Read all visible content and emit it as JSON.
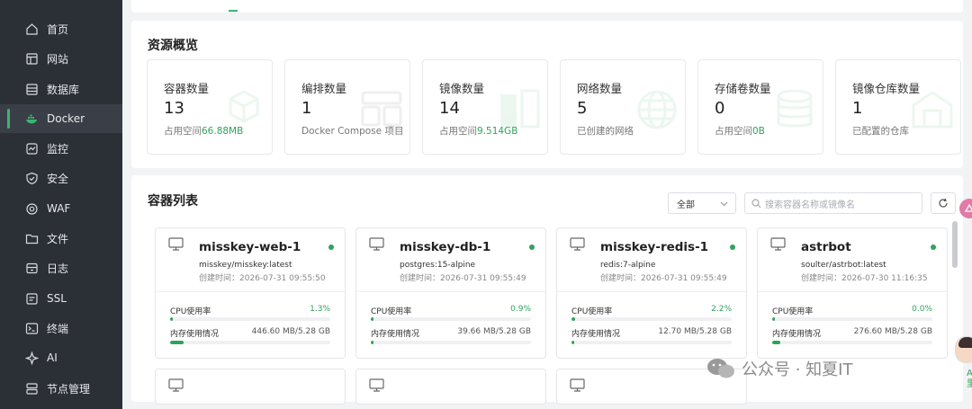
{
  "sidebar": {
    "items": [
      {
        "label": "首页",
        "icon": "home-icon"
      },
      {
        "label": "网站",
        "icon": "website-icon"
      },
      {
        "label": "数据库",
        "icon": "database-icon"
      },
      {
        "label": "Docker",
        "icon": "docker-icon",
        "active": true
      },
      {
        "label": "监控",
        "icon": "monitor-icon"
      },
      {
        "label": "安全",
        "icon": "shield-icon"
      },
      {
        "label": "WAF",
        "icon": "waf-icon"
      },
      {
        "label": "文件",
        "icon": "folder-icon"
      },
      {
        "label": "日志",
        "icon": "log-icon"
      },
      {
        "label": "SSL",
        "icon": "ssl-icon"
      },
      {
        "label": "终端",
        "icon": "terminal-icon"
      },
      {
        "label": "AI",
        "icon": "ai-icon"
      },
      {
        "label": "节点管理",
        "icon": "node-icon"
      }
    ]
  },
  "overview": {
    "title": "资源概览",
    "stats": [
      {
        "label": "容器数量",
        "value": "13",
        "sub_prefix": "占用空间",
        "sub_highlight": "66.88MB",
        "icon": "cubes-icon"
      },
      {
        "label": "编排数量",
        "value": "1",
        "sub_prefix": "Docker Compose 项目",
        "sub_highlight": "",
        "icon": "compose-icon"
      },
      {
        "label": "镜像数量",
        "value": "14",
        "sub_prefix": "占用空间",
        "sub_highlight": "9.514GB",
        "icon": "image-icon"
      },
      {
        "label": "网络数量",
        "value": "5",
        "sub_prefix": "已创建的网络",
        "sub_highlight": "",
        "icon": "globe-icon"
      },
      {
        "label": "存储卷数量",
        "value": "0",
        "sub_prefix": "占用空间",
        "sub_highlight": "0B",
        "icon": "volume-icon"
      },
      {
        "label": "镜像仓库数量",
        "value": "1",
        "sub_prefix": "已配置的仓库",
        "sub_highlight": "",
        "icon": "warehouse-icon"
      }
    ]
  },
  "containers": {
    "title": "容器列表",
    "filter": {
      "selected": "全部"
    },
    "search": {
      "placeholder": "搜索容器名称或镜像名"
    },
    "items": [
      {
        "name": "misskey-web-1",
        "image": "misskey/misskey:latest",
        "created": "创建时间：2026-07-31 09:55:50",
        "cpu_label": "CPU使用率",
        "cpu": "1.3%",
        "cpu_frac": 0.013,
        "mem_label": "内存使用情况",
        "mem": "446.60 MB/5.28 GB",
        "mem_frac": 0.083,
        "status": "running"
      },
      {
        "name": "misskey-db-1",
        "image": "postgres:15-alpine",
        "created": "创建时间：2026-07-31 09:55:49",
        "cpu_label": "CPU使用率",
        "cpu": "0.9%",
        "cpu_frac": 0.009,
        "mem_label": "内存使用情况",
        "mem": "39.66 MB/5.28 GB",
        "mem_frac": 0.008,
        "status": "running"
      },
      {
        "name": "misskey-redis-1",
        "image": "redis:7-alpine",
        "created": "创建时间：2026-07-31 09:55:49",
        "cpu_label": "CPU使用率",
        "cpu": "2.2%",
        "cpu_frac": 0.022,
        "mem_label": "内存使用情况",
        "mem": "12.70 MB/5.28 GB",
        "mem_frac": 0.003,
        "status": "running"
      },
      {
        "name": "astrbot",
        "image": "soulter/astrbot:latest",
        "created": "创建时间：2026-07-30 11:16:35",
        "cpu_label": "CPU使用率",
        "cpu": "0.0%",
        "cpu_frac": 0.0,
        "mem_label": "内存使用情况",
        "mem": "276.60 MB/5.28 GB",
        "mem_frac": 0.052,
        "status": "running"
      }
    ]
  },
  "watermark": {
    "text": "公众号 · 知夏IT"
  },
  "side_float": {
    "text": "A 里"
  },
  "colors": {
    "accent": "#2fa35a",
    "sidebar_bg": "#2b2f36"
  }
}
